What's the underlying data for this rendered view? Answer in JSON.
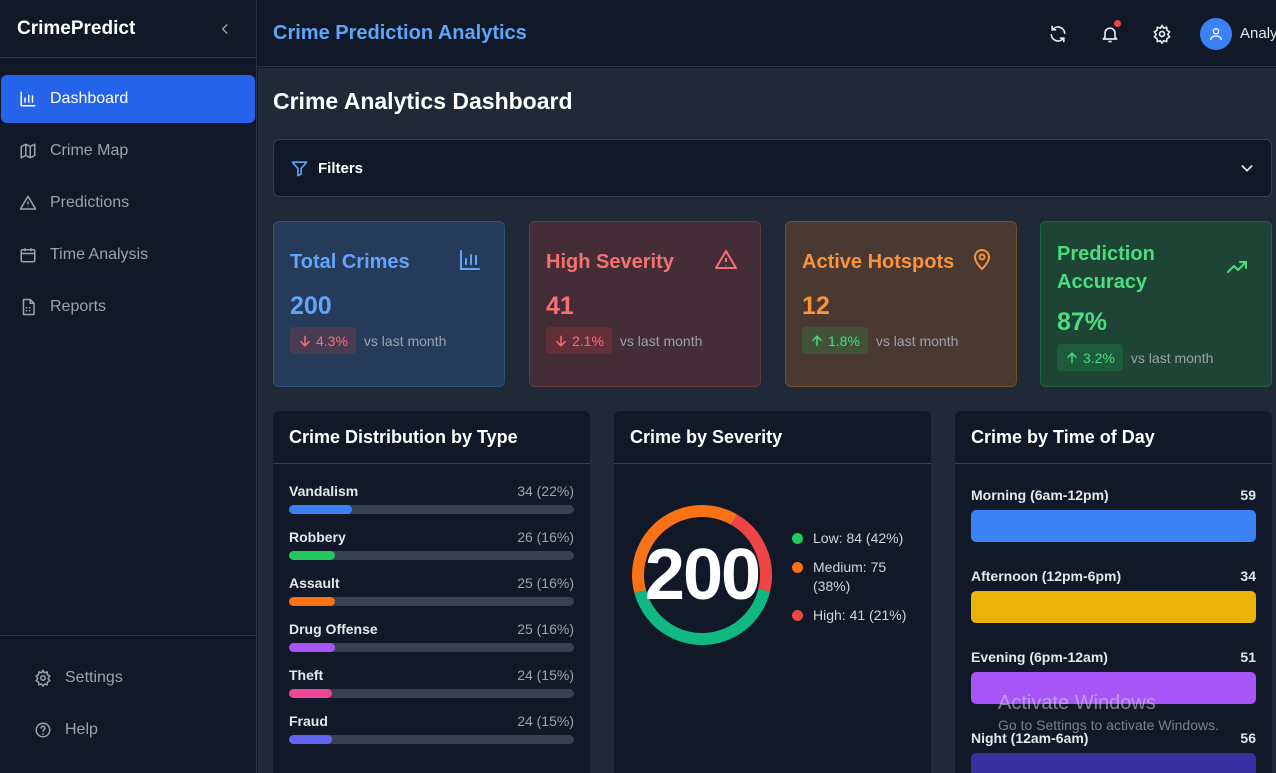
{
  "brand": {
    "name": "CrimePredict"
  },
  "sidebar": {
    "items": [
      {
        "label": "Dashboard",
        "icon": "bar-chart-icon",
        "active": true
      },
      {
        "label": "Crime Map",
        "icon": "map-icon"
      },
      {
        "label": "Predictions",
        "icon": "alert-triangle-icon"
      },
      {
        "label": "Time Analysis",
        "icon": "calendar-icon"
      },
      {
        "label": "Reports",
        "icon": "file-report-icon"
      }
    ],
    "bottom": [
      {
        "label": "Settings",
        "icon": "gear-icon"
      },
      {
        "label": "Help",
        "icon": "help-circle-icon"
      }
    ]
  },
  "topbar": {
    "title": "Crime Prediction Analytics",
    "user": "Analys"
  },
  "page": {
    "title": "Crime Analytics Dashboard"
  },
  "filters": {
    "label": "Filters"
  },
  "stats": [
    {
      "title": "Total Crimes",
      "value": "200",
      "change": "4.3%",
      "direction": "down",
      "vs": "vs last month",
      "color": "#60a5fa",
      "icon": "bar-chart-icon"
    },
    {
      "title": "High Severity",
      "value": "41",
      "change": "2.1%",
      "direction": "down",
      "vs": "vs last month",
      "color": "#f87171",
      "icon": "alert-triangle-icon"
    },
    {
      "title": "Active Hotspots",
      "value": "12",
      "change": "1.8%",
      "direction": "up",
      "vs": "vs last month",
      "color": "#fb923c",
      "icon": "map-pin-icon"
    },
    {
      "title": "Prediction Accuracy",
      "value": "87%",
      "change": "3.2%",
      "direction": "up",
      "vs": "vs last month",
      "color": "#4ade80",
      "icon": "trending-up-icon"
    }
  ],
  "panels": {
    "type": {
      "title": "Crime Distribution by Type"
    },
    "severity": {
      "title": "Crime by Severity"
    },
    "time": {
      "title": "Crime by Time of Day"
    }
  },
  "chart_data": [
    {
      "type": "bar",
      "title": "Crime Distribution by Type",
      "categories": [
        "Vandalism",
        "Robbery",
        "Assault",
        "Drug Offense",
        "Theft",
        "Fraud"
      ],
      "values": [
        34,
        26,
        25,
        25,
        24,
        24
      ],
      "labels": [
        "34 (22%)",
        "26 (16%)",
        "25 (16%)",
        "25 (16%)",
        "24 (15%)",
        "24 (15%)"
      ],
      "percent": [
        22,
        16,
        16,
        16,
        15,
        15
      ],
      "colors": [
        "#3b82f6",
        "#22c55e",
        "#f97316",
        "#a855f7",
        "#ec4899",
        "#6366f1"
      ]
    },
    {
      "type": "pie",
      "title": "Crime by Severity",
      "total": "200",
      "categories": [
        "Low",
        "Medium",
        "High"
      ],
      "values": [
        84,
        75,
        41
      ],
      "labels": [
        "Low: 84 (42%)",
        "Medium: 75 (38%)",
        "High: 41 (21%)"
      ],
      "colors": [
        "#22c55e",
        "#f97316",
        "#ef4444"
      ],
      "ring_colors": [
        "#10b981",
        "#f97316",
        "#ef4444"
      ]
    },
    {
      "type": "bar",
      "title": "Crime by Time of Day",
      "categories": [
        "Morning (6am-12pm)",
        "Afternoon (12pm-6pm)",
        "Evening (6pm-12am)",
        "Night (12am-6am)"
      ],
      "values": [
        59,
        34,
        51,
        56
      ],
      "colors": [
        "#3b82f6",
        "#eab308",
        "#a855f7",
        "#3730a3"
      ]
    }
  ],
  "watermark": {
    "line1": "Activate Windows",
    "line2": "Go to Settings to activate Windows."
  }
}
